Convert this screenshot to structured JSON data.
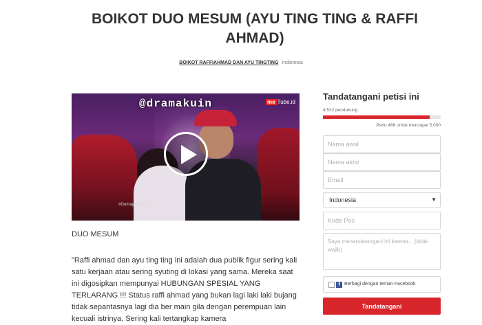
{
  "petition": {
    "title": "BOIKOT DUO MESUM (AYU TING TING & RAFFI AHMAD)",
    "author": "BOIKOT RAFFIAHMAD DAN AYU TINGTING",
    "country": "Indonesia"
  },
  "video": {
    "watermark": "@dramakuin",
    "brand_prefix": "me",
    "brand_suffix": "Tube.id",
    "tag": "#Gumaya@kanal...",
    "play_icon": "play-icon"
  },
  "content": {
    "heading": "DUO MESUM",
    "body": "\"Raffi ahmad dan ayu ting ting ini adalah dua publik figur sering kali satu kerjaan atau sering syuting di lokasi yang sama. Mereka saat ini digosipkan mempunyai HUBUNGAN SPESIAL YANG TERLARANG !!! Status raffi ahmad yang bukan lagi laki laki bujang tidak sepantasnya lagi dia ber main gila dengan perempuan lain kecuali istrinya. Sering kali tertangkap kamera"
  },
  "sign": {
    "title": "Tandatangani petisi ini",
    "supporters": "4.532 pendukung",
    "progress": 0.906,
    "remaining": "Perlu 468 untuk mencapai 5.000",
    "first_name_placeholder": "Nama awal",
    "last_name_placeholder": "Nama akhir",
    "email_placeholder": "Email",
    "country_value": "Indonesia",
    "postcode_placeholder": "Kode Pos",
    "reason_placeholder": "Saya menandatangani ini karena... (tidak wajib)",
    "share_label": "Berbagi dengan teman Facebook",
    "submit_label": "Tandatangani"
  },
  "colors": {
    "accent": "#d9262c",
    "facebook": "#3b5998"
  }
}
